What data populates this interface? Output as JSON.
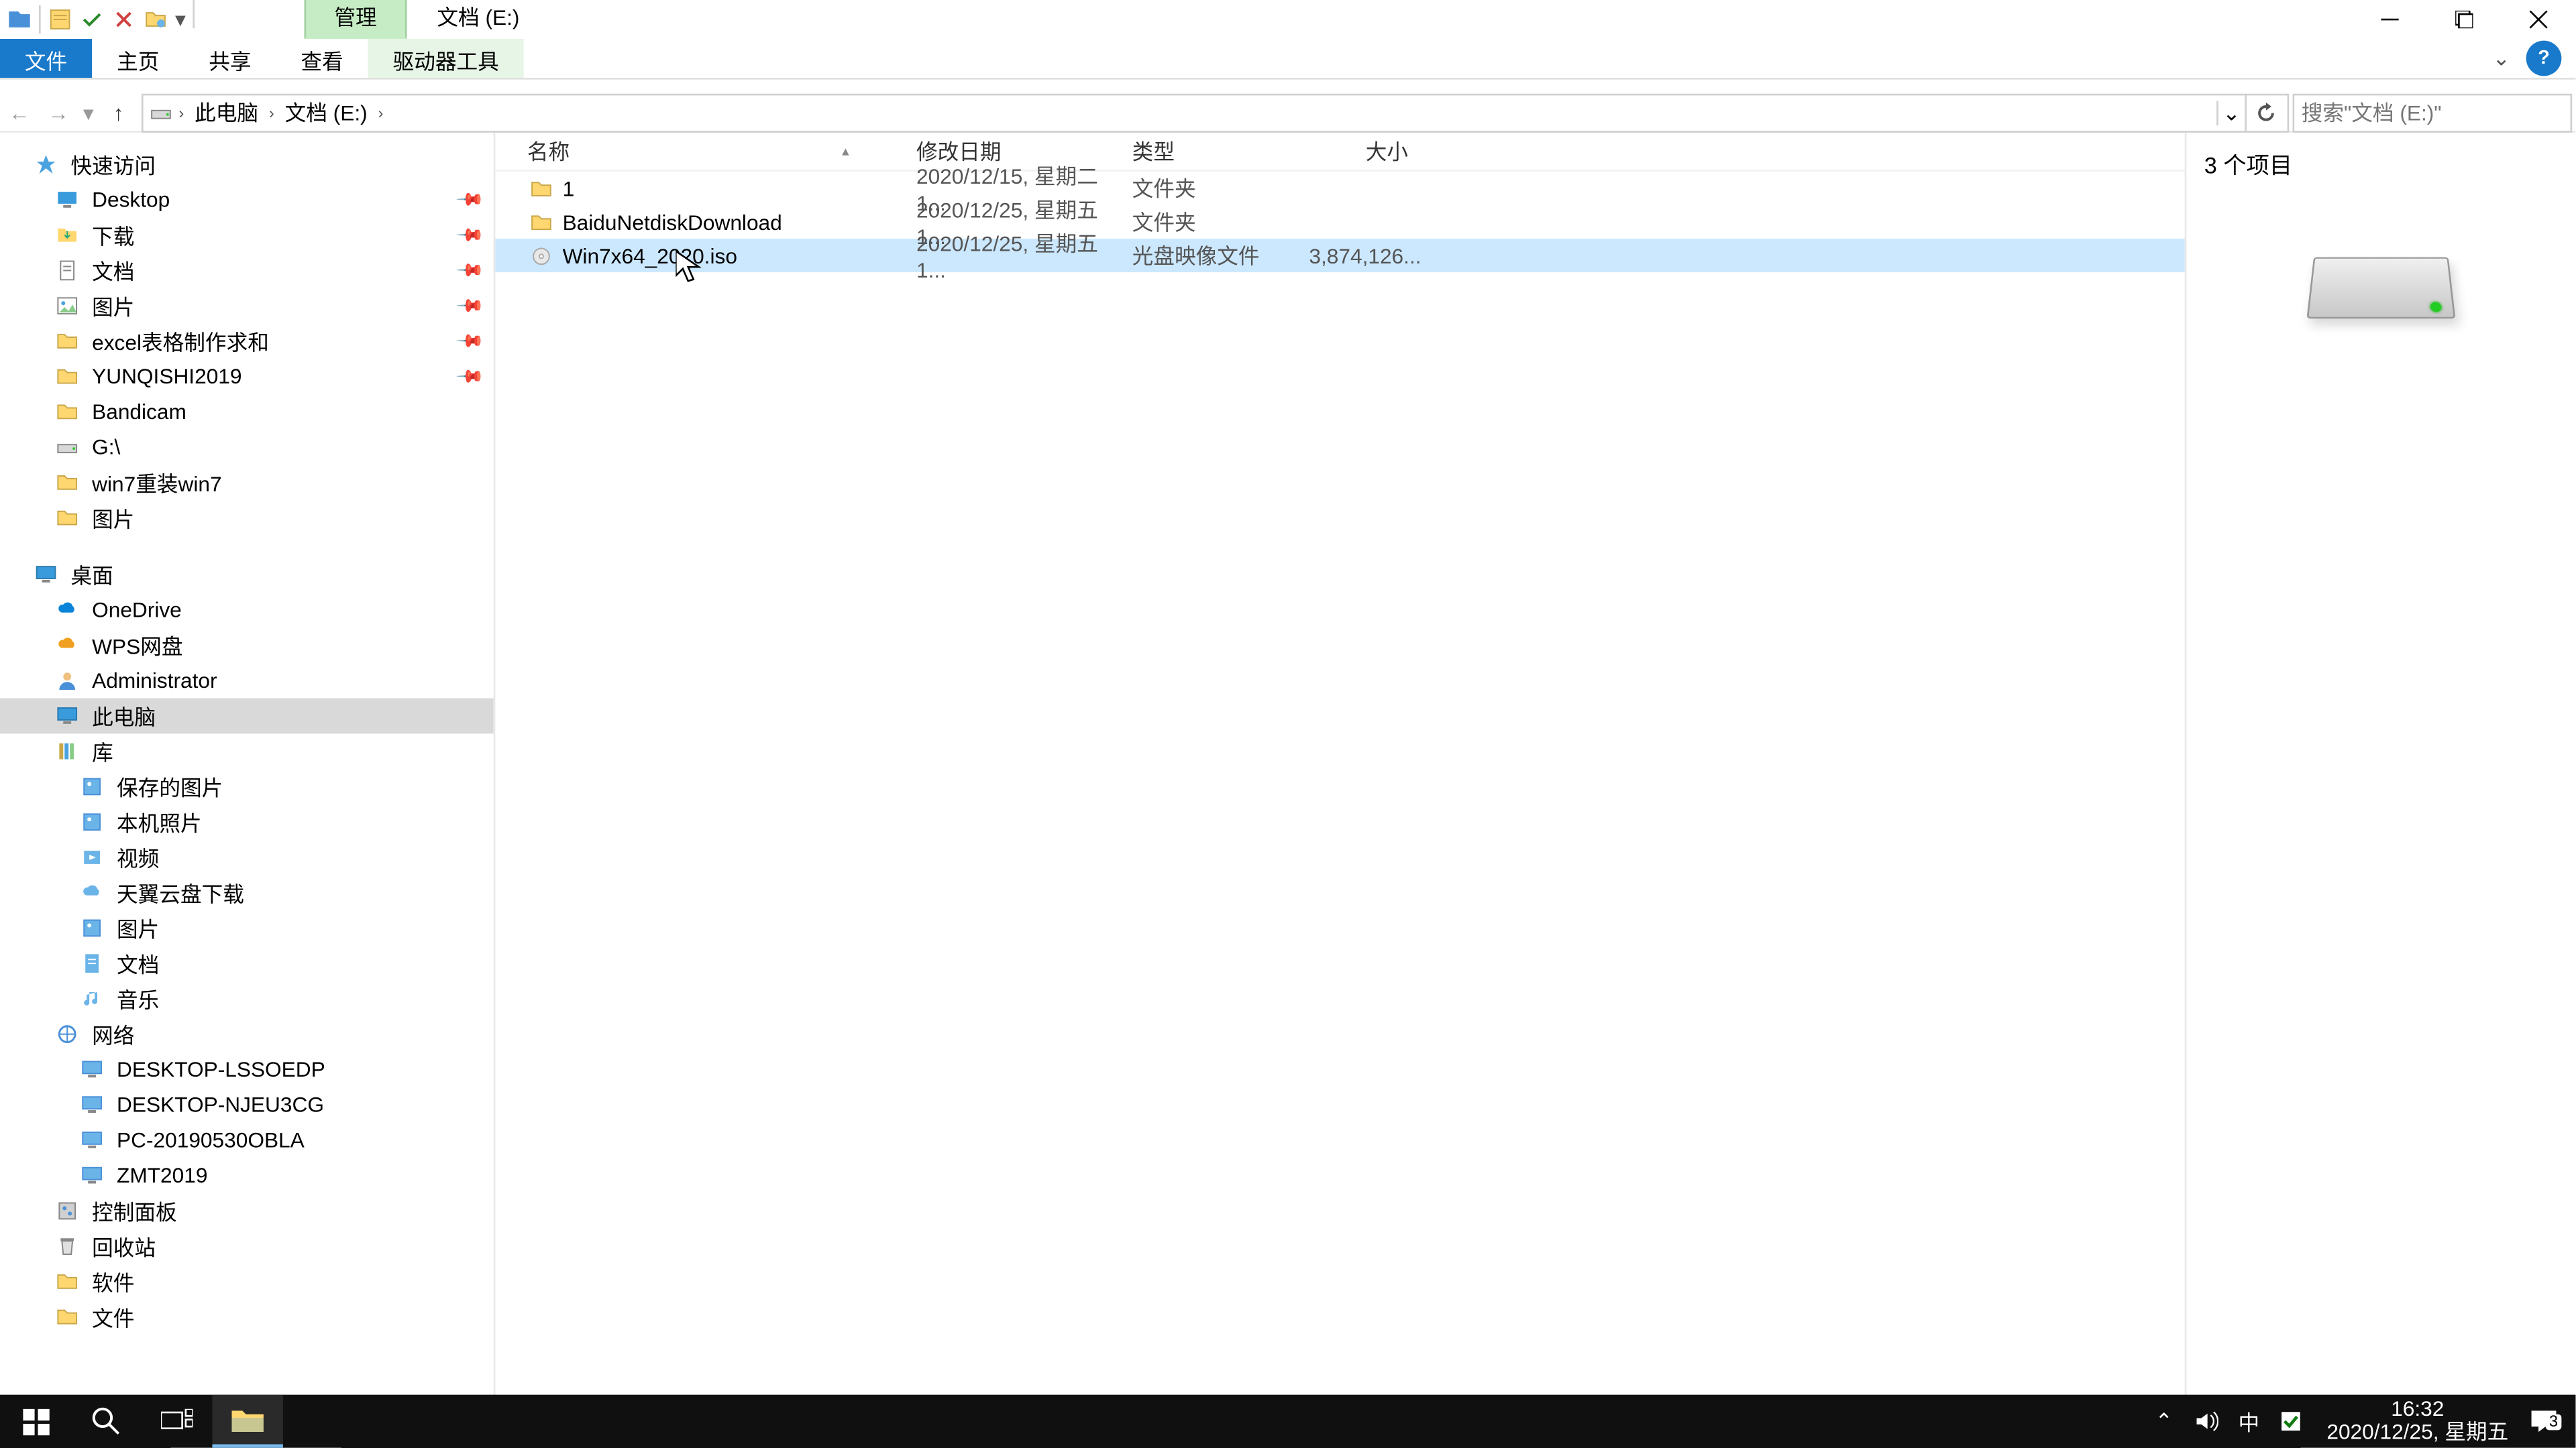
{
  "title_bar": {
    "context_tab": "管理",
    "location_title": "文档 (E:)"
  },
  "ribbon": {
    "file": "文件",
    "home": "主页",
    "share": "共享",
    "view": "查看",
    "drive_tools": "驱动器工具"
  },
  "breadcrumb": {
    "root": "此电脑",
    "current": "文档 (E:)"
  },
  "search": {
    "placeholder": "搜索\"文档 (E:)\""
  },
  "columns": {
    "name": "名称",
    "date": "修改日期",
    "type": "类型",
    "size": "大小"
  },
  "files": [
    {
      "name": "1",
      "date": "2020/12/15, 星期二 1...",
      "type": "文件夹",
      "size": "",
      "icon": "folder",
      "selected": false
    },
    {
      "name": "BaiduNetdiskDownload",
      "date": "2020/12/25, 星期五 1...",
      "type": "文件夹",
      "size": "",
      "icon": "folder",
      "selected": false
    },
    {
      "name": "Win7x64_2020.iso",
      "date": "2020/12/25, 星期五 1...",
      "type": "光盘映像文件",
      "size": "3,874,126...",
      "icon": "iso",
      "selected": true
    }
  ],
  "nav": {
    "quick_access": "快速访问",
    "quick": [
      {
        "label": "Desktop",
        "icon": "desktop",
        "pinned": true
      },
      {
        "label": "下载",
        "icon": "downloads",
        "pinned": true
      },
      {
        "label": "文档",
        "icon": "documents",
        "pinned": true
      },
      {
        "label": "图片",
        "icon": "pictures",
        "pinned": true
      },
      {
        "label": "excel表格制作求和",
        "icon": "folder",
        "pinned": true
      },
      {
        "label": "YUNQISHI2019",
        "icon": "folder",
        "pinned": true
      },
      {
        "label": "Bandicam",
        "icon": "folder",
        "pinned": false
      },
      {
        "label": "G:\\",
        "icon": "drive-usb",
        "pinned": false
      },
      {
        "label": "win7重装win7",
        "icon": "folder",
        "pinned": false
      },
      {
        "label": "图片",
        "icon": "folder",
        "pinned": false
      }
    ],
    "desktop_root": "桌面",
    "desktop": [
      {
        "label": "OneDrive",
        "icon": "cloud-blue"
      },
      {
        "label": "WPS网盘",
        "icon": "cloud-orange"
      },
      {
        "label": "Administrator",
        "icon": "user"
      },
      {
        "label": "此电脑",
        "icon": "pc",
        "selected": true
      },
      {
        "label": "库",
        "icon": "library"
      }
    ],
    "libraries": [
      {
        "label": "保存的图片",
        "icon": "lib-pic"
      },
      {
        "label": "本机照片",
        "icon": "lib-pic"
      },
      {
        "label": "视频",
        "icon": "lib-vid"
      },
      {
        "label": "天翼云盘下载",
        "icon": "lib-cloud"
      },
      {
        "label": "图片",
        "icon": "lib-pic"
      },
      {
        "label": "文档",
        "icon": "lib-doc"
      },
      {
        "label": "音乐",
        "icon": "lib-music"
      }
    ],
    "network": "网络",
    "network_items": [
      {
        "label": "DESKTOP-LSSOEDP",
        "icon": "netpc"
      },
      {
        "label": "DESKTOP-NJEU3CG",
        "icon": "netpc"
      },
      {
        "label": "PC-20190530OBLA",
        "icon": "netpc"
      },
      {
        "label": "ZMT2019",
        "icon": "netpc"
      }
    ],
    "control_panel": "控制面板",
    "recycle": "回收站",
    "software": "软件",
    "wenjian": "文件"
  },
  "details": {
    "count_text": "3 个项目"
  },
  "status": {
    "text": "3 个项目"
  },
  "taskbar": {
    "time": "16:32",
    "date": "2020/12/25, 星期五",
    "ime": "中",
    "notif_count": "3"
  }
}
